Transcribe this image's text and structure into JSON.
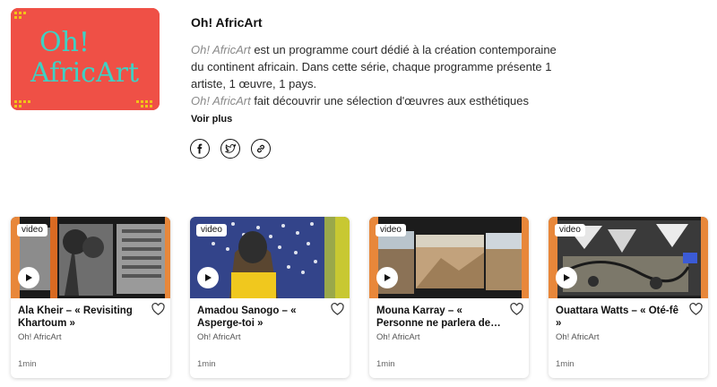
{
  "program": {
    "logo_text": "Oh! AfricArt",
    "title": "Oh! AfricArt",
    "desc_em1": "Oh! AfricArt",
    "desc_part1": " est un programme court dédié à la création contemporaine du continent africain. Dans cette série, chaque programme présente 1 artiste, 1 œuvre, 1 pays.",
    "desc_em2": "Oh! AfricArt",
    "desc_part2": " fait découvrir une sélection d'œuvres aux esthétiques",
    "voir_plus": "Voir plus",
    "share": [
      "facebook-icon",
      "twitter-icon",
      "link-icon"
    ]
  },
  "colors": {
    "logo_bg": "#ef5046",
    "logo_text": "#3ed1c4",
    "accent_yellow": "#f2c318"
  },
  "cards": [
    {
      "badge": "video",
      "title": "Ala Kheir – « Revisiting Khartoum »",
      "subtitle": "Oh! AfricArt",
      "duration": "1min"
    },
    {
      "badge": "video",
      "title": "Amadou Sanogo – « Asperge-toi »",
      "subtitle": "Oh! AfricArt",
      "duration": "1min"
    },
    {
      "badge": "video",
      "title": "Mouna Karray – « Personne ne parlera de…",
      "subtitle": "Oh! AfricArt",
      "duration": "1min"
    },
    {
      "badge": "video",
      "title": "Ouattara Watts – « Oté-fê »",
      "subtitle": "Oh! AfricArt",
      "duration": "1min"
    }
  ]
}
